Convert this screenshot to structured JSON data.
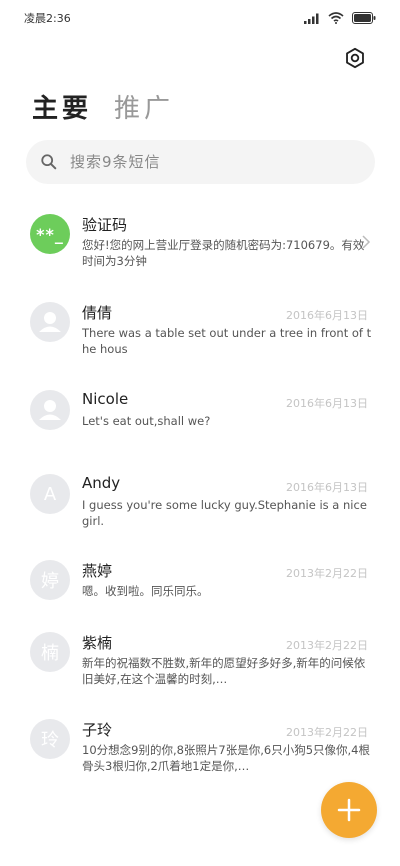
{
  "status_bar": {
    "time": "凌晨2:36"
  },
  "header": {
    "settings_icon": "gear-icon",
    "tabs": [
      {
        "label": "主要",
        "active": true
      },
      {
        "label": "推广",
        "active": false
      }
    ]
  },
  "search": {
    "placeholder": "搜索9条短信",
    "icon": "search-icon"
  },
  "messages": [
    {
      "avatar_text": "**_",
      "avatar_color": "#6dcd5b",
      "name": "验证码",
      "date": "",
      "snippet": "您好!您的网上营业厅登录的随机密码为:710679。有效时间为3分钟",
      "has_chevron": true
    },
    {
      "avatar_text": "",
      "avatar_icon": "person-icon",
      "name": "倩倩",
      "date": "2016年6月13日",
      "snippet": "There was a table set out under a tree in front of the hous"
    },
    {
      "avatar_text": "",
      "avatar_icon": "person-icon",
      "name": "Nicole",
      "date": "2016年6月13日",
      "snippet": "Let's eat out,shall we?"
    },
    {
      "avatar_text": "A",
      "name": "Andy",
      "date": "2016年6月13日",
      "snippet": "I guess you're some lucky guy.Stephanie is a nice girl."
    },
    {
      "avatar_text": "婷",
      "name": "燕婷",
      "date": "2013年2月22日",
      "snippet": "嗯。收到啦。同乐同乐。"
    },
    {
      "avatar_text": "楠",
      "name": "紫楠",
      "date": "2013年2月22日",
      "snippet": "新年的祝福数不胜数,新年的愿望好多好多,新年的问候依旧美好,在这个温馨的时刻,…"
    },
    {
      "avatar_text": "玲",
      "name": "子玲",
      "date": "2013年2月22日",
      "snippet": "10分想念9别的你,8张照片7张是你,6只小狗5只像你,4根骨头3根归你,2爪着地1定是你,…"
    }
  ],
  "fab": {
    "icon": "plus-icon",
    "color": "#f4a932"
  }
}
